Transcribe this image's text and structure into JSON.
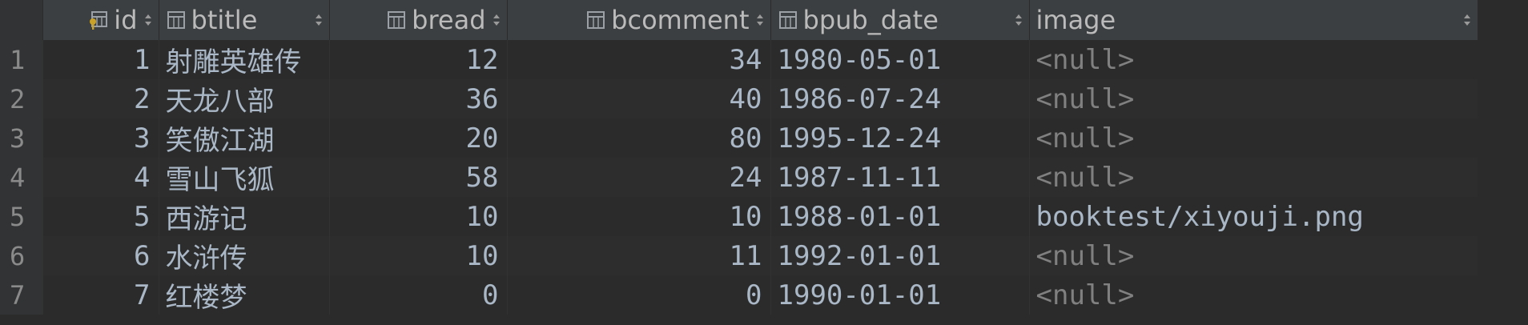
{
  "columns": [
    {
      "label": "id",
      "icon": "primary-key-column-icon",
      "align": "right"
    },
    {
      "label": "btitle",
      "icon": "column-icon",
      "align": "left"
    },
    {
      "label": "bread",
      "icon": "column-icon",
      "align": "right"
    },
    {
      "label": "bcomment",
      "icon": "column-icon",
      "align": "right"
    },
    {
      "label": "bpub_date",
      "icon": "column-icon",
      "align": "left"
    },
    {
      "label": "image",
      "icon": "none",
      "align": "left"
    }
  ],
  "rows": [
    {
      "num": "1",
      "id": "1",
      "btitle": "射雕英雄传",
      "bread": "12",
      "bcomment": "34",
      "bpub_date": "1980-05-01",
      "image": "<null>"
    },
    {
      "num": "2",
      "id": "2",
      "btitle": "天龙八部",
      "bread": "36",
      "bcomment": "40",
      "bpub_date": "1986-07-24",
      "image": "<null>"
    },
    {
      "num": "3",
      "id": "3",
      "btitle": "笑傲江湖",
      "bread": "20",
      "bcomment": "80",
      "bpub_date": "1995-12-24",
      "image": "<null>"
    },
    {
      "num": "4",
      "id": "4",
      "btitle": "雪山飞狐",
      "bread": "58",
      "bcomment": "24",
      "bpub_date": "1987-11-11",
      "image": "<null>"
    },
    {
      "num": "5",
      "id": "5",
      "btitle": "西游记",
      "bread": "10",
      "bcomment": "10",
      "bpub_date": "1988-01-01",
      "image": "booktest/xiyouji.png"
    },
    {
      "num": "6",
      "id": "6",
      "btitle": "水浒传",
      "bread": "10",
      "bcomment": "11",
      "bpub_date": "1992-01-01",
      "image": "<null>"
    },
    {
      "num": "7",
      "id": "7",
      "btitle": "红楼梦",
      "bread": "0",
      "bcomment": "0",
      "bpub_date": "1990-01-01",
      "image": "<null>"
    }
  ],
  "colors": {
    "background": "#2b2b2b",
    "header_background": "#3c3f41",
    "text": "#a9b7c6",
    "null_text": "#808080",
    "key_icon": "#c9a227"
  }
}
